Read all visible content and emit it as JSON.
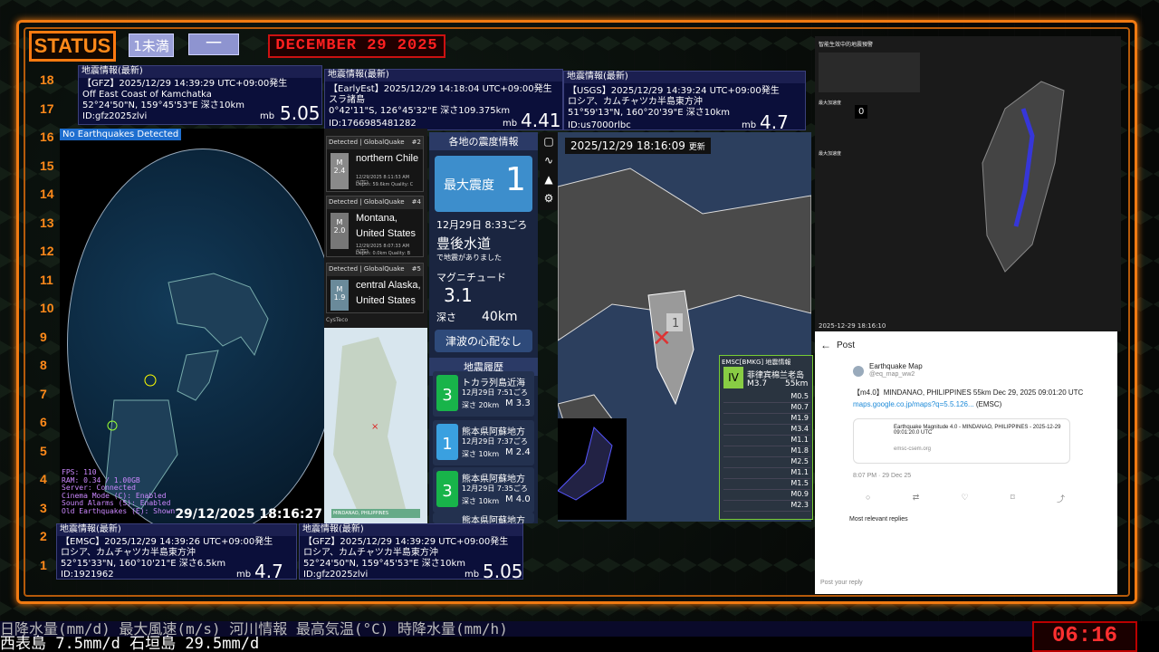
{
  "status": {
    "label": "STATUS",
    "btn1": "1未満",
    "btn2": "一",
    "date": "DECEMBER 29 2025"
  },
  "ruler": [
    "18",
    "17",
    "16",
    "15",
    "14",
    "13",
    "12",
    "11",
    "10",
    "9",
    "8",
    "7",
    "6",
    "5",
    "4",
    "3",
    "2",
    "1"
  ],
  "eq_gfz_top": {
    "header": "地震情報(最新)",
    "line1": "【GFZ】2025/12/29 14:39:29 UTC+09:00発生",
    "line2": "Off East Coast of Kamchatka",
    "line3": "52°24'50\"N, 159°45'53\"E 深さ10km",
    "line4": "ID:gfz2025zlvi",
    "mb": "mb",
    "mag": "5.05"
  },
  "eq_early": {
    "header": "地震情報(最新)",
    "line1": "【EarlyEst】2025/12/29 14:18:04 UTC+09:00発生",
    "line2": "スラ諸島",
    "line3": "0°42'11\"S, 126°45'32\"E 深さ109.375km",
    "line4": "ID:1766985481282",
    "mb": "mb",
    "mag": "4.41"
  },
  "eq_usgs": {
    "header": "地震情報(最新)",
    "line1": "【USGS】2025/12/29 14:39:24 UTC+09:00発生",
    "line2": "ロシア、カムチャツカ半島東方沖",
    "line3": "51°59'13\"N, 160°20'39\"E 深さ10km",
    "line4": "ID:us7000rlbc",
    "mb": "mb",
    "mag": "4.7"
  },
  "eq_emsc": {
    "header": "地震情報(最新)",
    "line1": "【EMSC】2025/12/29 14:39:26 UTC+09:00発生",
    "line2": "ロシア、カムチャツカ半島東方沖",
    "line3": "52°15'33\"N, 160°10'21\"E 深さ6.5km",
    "line4": "ID:1921962",
    "mb": "mb",
    "mag": "4.7"
  },
  "eq_gfz_bot": {
    "header": "地震情報(最新)",
    "line1": "【GFZ】2025/12/29 14:39:29 UTC+09:00発生",
    "line2": "ロシア、カムチャツカ半島東方沖",
    "line3": "52°24'50\"N, 159°45'53\"E 深さ10km",
    "line4": "ID:gfz2025zlvi",
    "mb": "mb",
    "mag": "5.05"
  },
  "globe": {
    "badge": "No Earthquakes Detected",
    "time": "29/12/2025 18:16:27",
    "info": [
      "FPS: 110",
      "RAM: 0.34 / 1.00GB",
      "Server: Connected",
      "Cinema Mode (C): Enabled",
      "Sound Alarms (S): Enabled",
      "Old Earthquakes (E): Shown"
    ]
  },
  "gq": [
    {
      "head": "Detected | GlobalQuake",
      "num": "#2",
      "m": "M",
      "mv": "2.4",
      "place": "northern Chile",
      "sub1": "12/29/2025 8:11:53 AM (UTC)",
      "sub2": "Depth: 59.6km Quality: C"
    },
    {
      "head": "Detected | GlobalQuake",
      "num": "#4",
      "m": "M",
      "mv": "2.0",
      "place": "Montana, United States",
      "sub1": "12/29/2025 8:07:33 AM (UTC)",
      "sub2": "Depth: 0.0km Quality: B"
    },
    {
      "head": "Detected | GlobalQuake",
      "num": "#5",
      "m": "M",
      "mv": "1.9",
      "place": "central Alaska, United States",
      "sub1": "",
      "sub2": ""
    }
  ],
  "gq_footer": "CysTeco",
  "minimap": {
    "label": "MINDANAO, PHILIPPINES"
  },
  "jma": {
    "title": "各地の震度情報",
    "maxlabel": "最大震度",
    "maxval": "1",
    "time": "12月29日 8:33ごろ",
    "place": "豊後水道",
    "desc": "で地震がありました",
    "magl": "マグニチュード",
    "magv": "3.1",
    "depl": "深さ",
    "depv": "40km",
    "tsunami": "津波の心配なし",
    "histtitle": "地震履歴"
  },
  "hist": [
    {
      "s": "3",
      "place": "トカラ列島近海",
      "time": "12月29日 7:51ごろ",
      "dep": "深さ 20km",
      "m": "M 3.3"
    },
    {
      "s": "1",
      "place": "熊本県阿蘇地方",
      "time": "12月29日 7:37ごろ",
      "dep": "深さ 10km",
      "m": "M 2.4"
    },
    {
      "s": "3",
      "place": "熊本県阿蘇地方",
      "time": "12月29日 7:35ごろ",
      "dep": "深さ 10km",
      "m": "M 4.0"
    },
    {
      "s": "",
      "place": "熊本県阿蘇地方",
      "time": "",
      "dep": "",
      "m": ""
    }
  ],
  "mapc": {
    "time": "2025/12/29 18:16:09",
    "upd": "更新",
    "pin": "1"
  },
  "emsc": {
    "title": "EMSC[BMKG] 地震情報",
    "scale": "IV",
    "place": "菲律宾棉兰老岛",
    "mag": "M3.7",
    "dep": "55km",
    "list": [
      "M0.5",
      "M0.7",
      "M1.9",
      "M3.4",
      "M1.1",
      "M1.8",
      "M2.5",
      "M1.1",
      "M1.5",
      "M0.9",
      "M2.3"
    ]
  },
  "tw": {
    "title": "智能生效中的地震預警",
    "ts": "2025-12-29 18:16:10",
    "num": "0",
    "lab1": "最大加速度",
    "lab2": "最大加速度"
  },
  "post": {
    "title": "Post",
    "user": "Earthquake Map",
    "handle": "@eq_map_ww2",
    "body": "【m4.0】MINDANAO, PHILIPPINES 55km Dec 29, 2025 09:01:20 UTC",
    "link": "maps.google.co.jp/maps?q=5.5.126...",
    "src": "(EMSC)",
    "card": "Earthquake Magnitude 4.0 - MINDANAO, PHILIPPINES - 2025-12-29 09:01:20.0 UTC",
    "cardsrc": "emsc-csem.org",
    "time": "8:07 PM · 29 Dec 25",
    "sort": "Most relevant replies",
    "reply": "Post your reply"
  },
  "ticker": {
    "line1": "日降水量(mm/d) 最大風速(m/s) 河川情報 最高気温(°C) 時降水量(mm/h)",
    "line2": "西表島 7.5mm/d 石垣島 29.5mm/d"
  },
  "clock": "06:16"
}
